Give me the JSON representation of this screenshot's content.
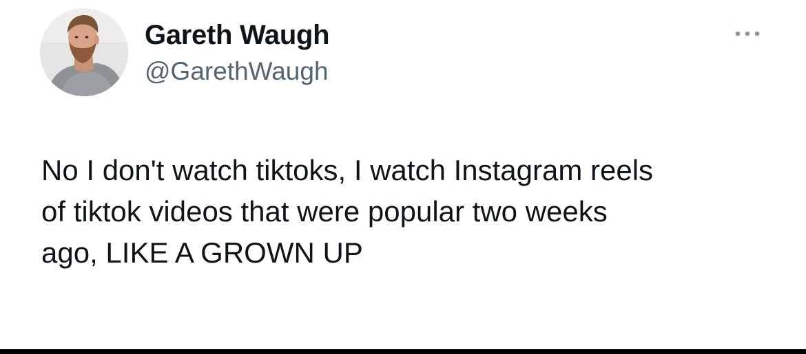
{
  "author": {
    "display_name": "Gareth Waugh",
    "handle": "@GarethWaugh"
  },
  "tweet": {
    "lines": [
      "No I don't watch tiktoks, I watch Instagram reels",
      "of tiktok videos that were popular two weeks",
      "ago, LIKE A GROWN UP"
    ]
  },
  "icons": {
    "more": "more-horizontal-icon"
  },
  "colors": {
    "text_primary": "#0f1419",
    "text_secondary": "#536471",
    "background": "#ffffff",
    "more_icon": "#8b98a5"
  }
}
